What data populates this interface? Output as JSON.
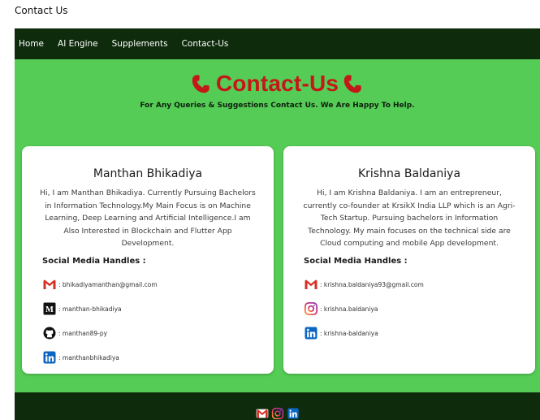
{
  "page": {
    "heading": "Contact Us"
  },
  "nav": {
    "items": [
      {
        "label": "Home"
      },
      {
        "label": "AI Engine"
      },
      {
        "label": "Supplements"
      },
      {
        "label": "Contact-Us"
      }
    ]
  },
  "hero": {
    "title": "Contact-Us",
    "subtitle": "For Any Queries & Suggestions Contact Us. We Are Happy To Help."
  },
  "cards": [
    {
      "name": "Manthan Bhikadiya",
      "bio": "Hi, I am Manthan Bhikadiya. Currently Pursuing Bachelors in Information Technology.My Main Focus is on Machine Learning, Deep Learning and Artificial Intelligence.I am Also Interested in Blockchain and Flutter App Development.",
      "handles_title": "Social Media Handles :",
      "handles": [
        {
          "icon": "gmail-icon",
          "text": ": bhikadiyamanthan@gmail.com"
        },
        {
          "icon": "medium-icon",
          "text": ": manthan-bhikadiya"
        },
        {
          "icon": "github-icon",
          "text": ": manthan89-py"
        },
        {
          "icon": "linkedin-icon",
          "text": ": manthanbhikadiya"
        }
      ]
    },
    {
      "name": "Krishna Baldaniya",
      "bio": "Hi, I am Krishna Baldaniya. I am an entrepreneur, currently co-founder at KrsikX India LLP which is an Agri-Tech Startup. Pursuing bachelors in Information Technology. My main focuses on the technical side are Cloud computing and mobile App development.",
      "handles_title": "Social Media Handles :",
      "handles": [
        {
          "icon": "gmail-icon",
          "text": ": krishna.baldaniya93@gmail.com"
        },
        {
          "icon": "instagram-icon",
          "text": ": krishna.baldaniya"
        },
        {
          "icon": "linkedin-icon",
          "text": ": krishna-baldaniya"
        }
      ]
    }
  ],
  "footer": {
    "icons": [
      "gmail-icon",
      "instagram-icon",
      "linkedin-icon"
    ]
  },
  "colors": {
    "nav_bg": "#0e2b0c",
    "hero_bg": "#55cc55",
    "title_red": "#c41818",
    "card_bg": "#ffffff"
  }
}
